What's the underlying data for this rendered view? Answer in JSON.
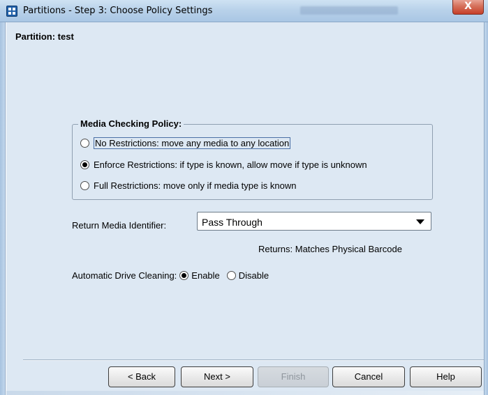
{
  "window": {
    "title": "Partitions - Step 3: Choose Policy Settings",
    "close_label": "X"
  },
  "partition": {
    "label": "Partition: test"
  },
  "media_checking": {
    "legend": "Media Checking Policy:",
    "options": [
      {
        "label": "No Restrictions: move any media to any location",
        "selected": false
      },
      {
        "label": "Enforce Restrictions: if type is known, allow move if type is unknown",
        "selected": true
      },
      {
        "label": "Full Restrictions: move only if media type is known",
        "selected": false
      }
    ]
  },
  "return_media": {
    "label": "Return Media Identifier:",
    "value": "Pass Through",
    "returns_text": "Returns: Matches Physical Barcode"
  },
  "cleaning": {
    "label": "Automatic Drive Cleaning:",
    "enable_label": "Enable",
    "disable_label": "Disable",
    "selected": "Enable"
  },
  "buttons": {
    "back": "< Back",
    "next": "Next >",
    "finish": "Finish",
    "cancel": "Cancel",
    "help": "Help"
  }
}
